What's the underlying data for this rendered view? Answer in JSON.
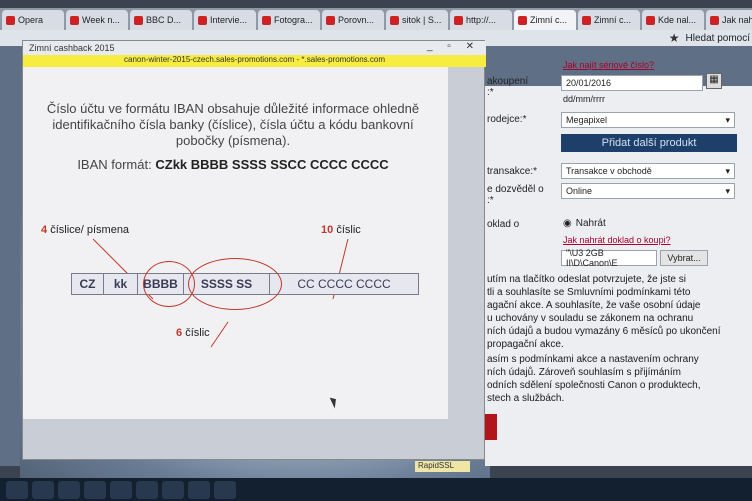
{
  "browser": {
    "tabs": [
      {
        "label": "Opera"
      },
      {
        "label": "Week n..."
      },
      {
        "label": "BBC D..."
      },
      {
        "label": "Intervie..."
      },
      {
        "label": "Fotogra..."
      },
      {
        "label": "Porovn..."
      },
      {
        "label": "sitok | S..."
      },
      {
        "label": "http://..."
      },
      {
        "label": "Zimní c..."
      },
      {
        "label": "Zimní c..."
      },
      {
        "label": "Kde nal..."
      },
      {
        "label": "Jak nah..."
      }
    ],
    "bookmark_label": "Hledat pomocí"
  },
  "form": {
    "serial_link": "Jak najít sériové číslo?",
    "purchase_label": "akoupení\n:*",
    "purchase_date": "20/01/2016",
    "date_format": "dd/mm/rrrr",
    "seller_label": "rodejce:*",
    "seller_value": "Megapixel",
    "add_product": "Přidat další produkt",
    "transaction_label": "transakce:*",
    "transaction_value": "Transakce v obchodě",
    "learned_label": "e dozvěděl o\n:*",
    "learned_value": "Online",
    "proof_label": "oklad o",
    "upload_label": "Nahrát",
    "proof_link": "Jak nahrát doklad o koupi?",
    "file_path": "\"\\U3 2GB II\\D\\Canon\\E",
    "browse_button": "Vybrat...",
    "para1": "utím na tlačítko odeslat potvrzujete, že jste si\ntli a souhlasíte se Smluvními podmínkami této\nagační akce. A souhlasíte, že vaše osobní údaje\nu uchovány v souladu se zákonem na ochranu\nních údajů a budou vymazány 6 měsíců po ukončení\npropagační akce.",
    "para2": "asím s podmínkami akce a nastavením ochrany\nních údajů. Zároveň souhlasím s přijímáním\nodních sdělení společnosti Canon o produktech,\nstech a službách."
  },
  "popup": {
    "title": "Zimní cashback 2015",
    "url": "canon-winter-2015-czech.sales-promotions.com - *.sales-promotions.com",
    "heading": "Číslo účtu ve formátu IBAN obsahuje důležité informace ohledně identifikačního čísla banky (číslice), čísla účtu a kódu bankovní pobočky (písmena).",
    "iban_prefix": "IBAN formát:",
    "iban_format": "CZkk BBBB SSSS SSCC CCCC CCCC",
    "label_left_num": "4",
    "label_left": "číslice/ písmena",
    "label_right_num": "10",
    "label_right": "číslic",
    "label_bottom_num": "6",
    "label_bottom": "číslic",
    "segments": [
      "CZ",
      "kk",
      "BBBB",
      "SSSS SS",
      "CC CCCC CCCC"
    ]
  },
  "rapidssl": "RapidSSL"
}
